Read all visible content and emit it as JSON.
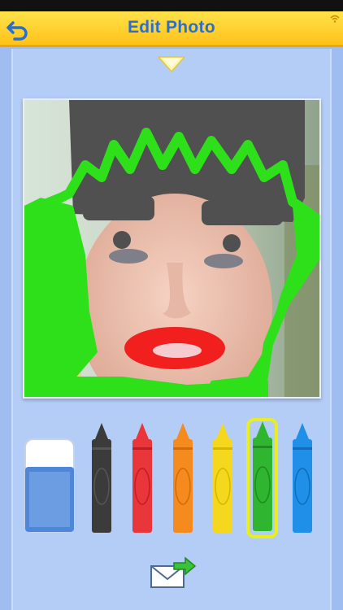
{
  "header": {
    "title": "Edit Photo"
  },
  "palette": {
    "tools": [
      "eraser",
      "black",
      "red",
      "orange",
      "yellow",
      "green",
      "blue"
    ],
    "selected": "green",
    "colors": {
      "black": "#3b3b3b",
      "red": "#e8363a",
      "orange": "#f58a1f",
      "yellow": "#f5d81e",
      "green": "#2fb52f",
      "blue": "#1f8fe8"
    }
  },
  "icons": {
    "back": "back-arrow-icon",
    "wifi": "wifi-icon",
    "dropdown": "triangle-down-icon",
    "send": "envelope-send-icon"
  },
  "colors": {
    "header": "#ffc21a",
    "title": "#2a6fc9",
    "background": "#9fbdf0"
  }
}
